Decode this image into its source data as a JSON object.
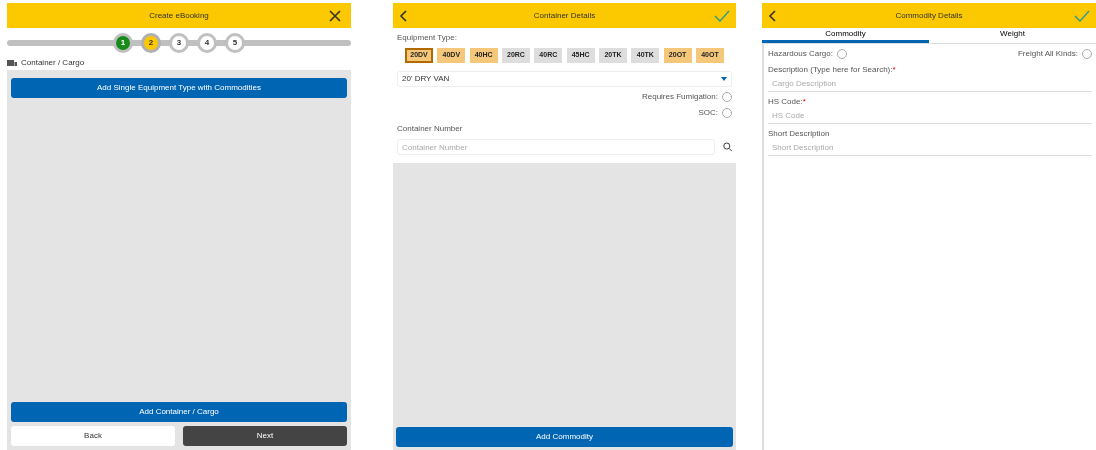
{
  "booking": {
    "title": "Create eBooking",
    "steps": [
      {
        "label": "1",
        "completed": true,
        "selected": false
      },
      {
        "label": "2",
        "completed": false,
        "selected": true
      },
      {
        "label": "3",
        "completed": false,
        "selected": false
      },
      {
        "label": "4",
        "completed": false,
        "selected": false
      },
      {
        "label": "5",
        "completed": false,
        "selected": false
      }
    ],
    "section": "Container / Cargo",
    "add_single_button": "Add Single Equipment Type with Commodities",
    "add_container_button": "Add Container / Cargo",
    "back_button": "Back",
    "next_button": "Next"
  },
  "container": {
    "title": "Container Details",
    "equipment_label": "Equipment Type:",
    "equipment": [
      {
        "code": "20DV",
        "selected": true,
        "color": "#f5c77a"
      },
      {
        "code": "40DV",
        "selected": false,
        "color": "#f5c77a"
      },
      {
        "code": "40HC",
        "selected": false,
        "color": "#f5c77a"
      },
      {
        "code": "20RC",
        "selected": false,
        "color": "#dddddd"
      },
      {
        "code": "40RC",
        "selected": false,
        "color": "#dddddd"
      },
      {
        "code": "45HC",
        "selected": false,
        "color": "#dddddd"
      },
      {
        "code": "20TK",
        "selected": false,
        "color": "#dddddd"
      },
      {
        "code": "40TK",
        "selected": false,
        "color": "#dddddd"
      },
      {
        "code": "20OT",
        "selected": false,
        "color": "#f5c77a"
      },
      {
        "code": "40OT",
        "selected": false,
        "color": "#f5c77a"
      }
    ],
    "type_value": "20' DRY VAN",
    "options": [
      {
        "label": "Requires Fumigation:",
        "checked": false
      },
      {
        "label": "SOC:",
        "checked": false
      }
    ],
    "number_label": "Container Number",
    "number_placeholder": "Container Number",
    "add_commodity_button": "Add Commodity"
  },
  "commodity": {
    "title": "Commodity Details",
    "tabs": [
      {
        "label": "Commodity",
        "selected": true
      },
      {
        "label": "Weight",
        "selected": false
      }
    ],
    "hazardous": {
      "label": "Hazardous Cargo:",
      "checked": false
    },
    "freight": {
      "label": "Freight All Kinds:",
      "checked": false
    },
    "fields": [
      {
        "label": "Description (Type here for Search):",
        "required_mark": "*",
        "placeholder": "Cargo Description"
      },
      {
        "label": "HS Code:",
        "required_mark": "*",
        "placeholder": "HS Code"
      },
      {
        "label": "Short Description",
        "placeholder": "Short Description"
      }
    ]
  }
}
